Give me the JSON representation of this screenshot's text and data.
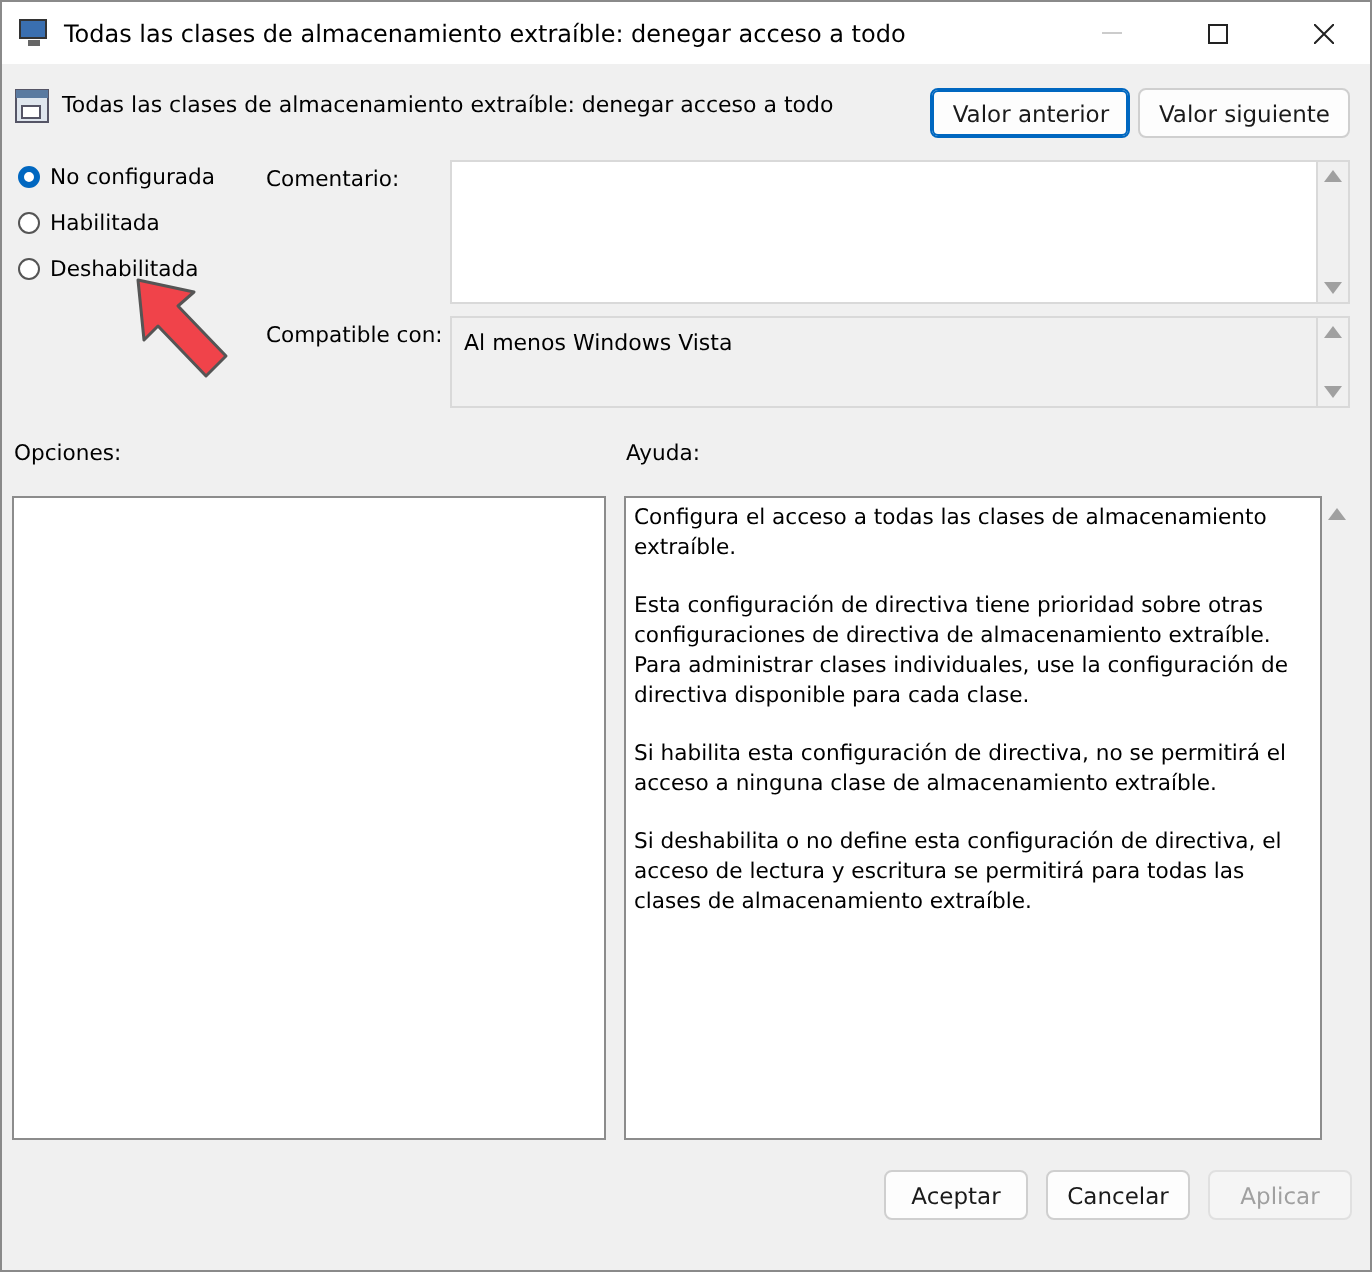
{
  "window": {
    "title": "Todas las clases de almacenamiento extraíble: denegar acceso a todo"
  },
  "header": {
    "title": "Todas las clases de almacenamiento extraíble: denegar acceso a todo",
    "buttons": [
      {
        "label": "Valor anterior",
        "focused": true
      },
      {
        "label": "Valor siguiente",
        "focused": false
      }
    ]
  },
  "states": [
    {
      "label": "No configurada",
      "selected": true
    },
    {
      "label": "Habilitada",
      "selected": false
    },
    {
      "label": "Deshabilitada",
      "selected": false
    }
  ],
  "comment": {
    "label": "Comentario:"
  },
  "compatible": {
    "label": "Compatible con:",
    "value": "Al menos Windows Vista"
  },
  "options": {
    "label": "Opciones:"
  },
  "help": {
    "label": "Ayuda:",
    "paragraphs": [
      "Configura el acceso a todas las clases de almacenamiento extraíble.",
      "Esta configuración de directiva tiene prioridad sobre otras configuraciones de directiva de almacenamiento extraíble. Para administrar clases individuales, use la configuración de directiva disponible para cada clase.",
      "Si habilita esta configuración de directiva, no se permitirá el acceso a ninguna clase de almacenamiento extraíble.",
      "Si deshabilita o no define esta configuración de directiva, el acceso de lectura y escritura se permitirá para todas las clases de almacenamiento extraíble."
    ]
  },
  "footer": {
    "buttons": [
      {
        "label": "Aceptar",
        "disabled": false
      },
      {
        "label": "Cancelar",
        "disabled": false
      },
      {
        "label": "Aplicar",
        "disabled": true
      }
    ]
  }
}
